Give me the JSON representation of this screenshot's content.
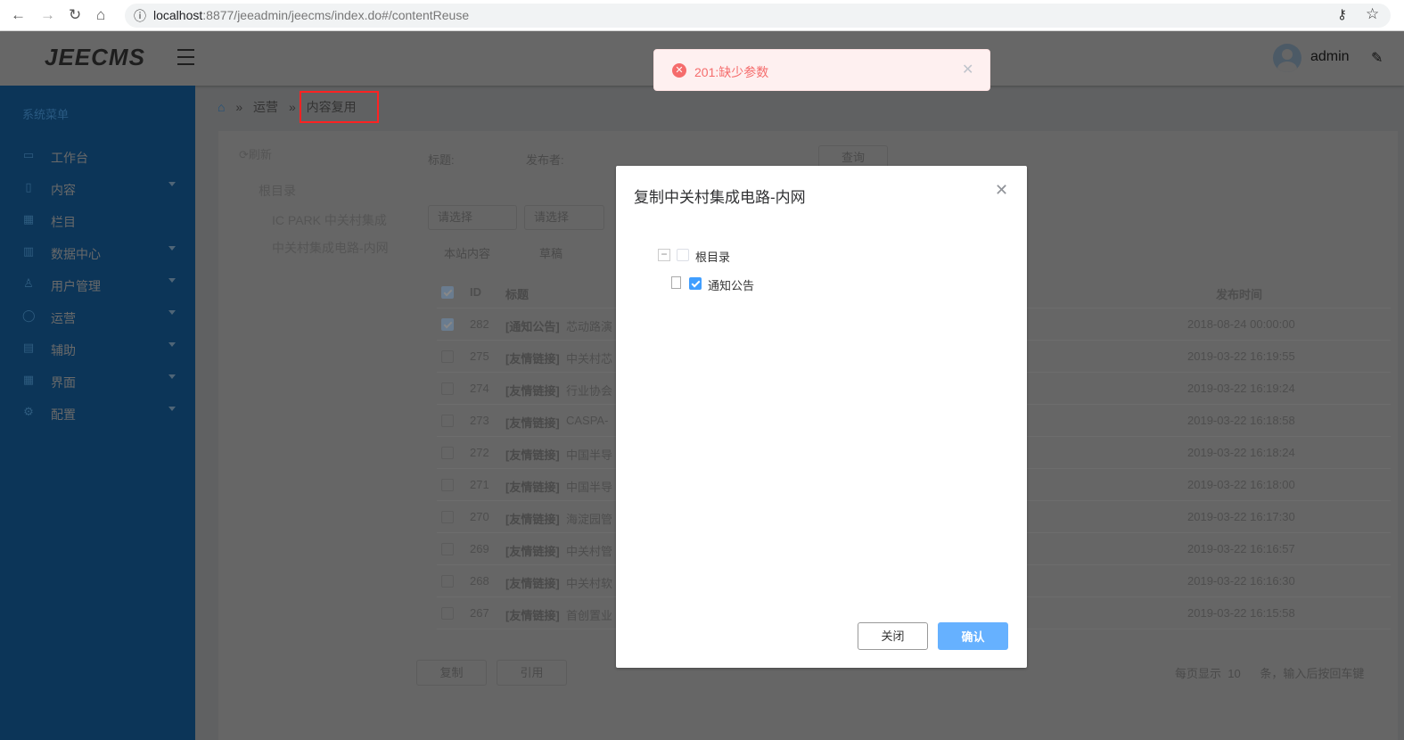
{
  "browser": {
    "url_host": "localhost",
    "url_path": ":8877/jeeadmin/jeecms/index.do#/contentReuse",
    "back": "←",
    "forward": "→",
    "reload": "↻",
    "home": "⌂",
    "info": "ⓘ",
    "key": "⚷",
    "star": "☆"
  },
  "header": {
    "logo": "JEECMS",
    "user": "admin",
    "edit_icon": "✎"
  },
  "sidebar": {
    "caption": "系统菜单",
    "items": [
      {
        "label": "工作台",
        "icon": "▭",
        "arrow": false
      },
      {
        "label": "内容",
        "icon": "▯",
        "arrow": true
      },
      {
        "label": "栏目",
        "icon": "▦",
        "arrow": false
      },
      {
        "label": "数据中心",
        "icon": "▥",
        "arrow": true
      },
      {
        "label": "用户管理",
        "icon": "♙",
        "arrow": true
      },
      {
        "label": "运营",
        "icon": "◯",
        "arrow": true
      },
      {
        "label": "辅助",
        "icon": "▤",
        "arrow": true
      },
      {
        "label": "界面",
        "icon": "▦",
        "arrow": true
      },
      {
        "label": "配置",
        "icon": "⚙",
        "arrow": true
      }
    ]
  },
  "breadcrumb": {
    "home": "⌂",
    "sep": "»",
    "items": [
      "运营",
      "内容复用"
    ]
  },
  "content": {
    "refresh": "⟳刷新",
    "tree": [
      "根目录",
      "IC PARK 中关村集成",
      "中关村集成电路-内网"
    ],
    "filters": {
      "title_label": "标题:",
      "publisher_label": "发布者:",
      "query": "查询",
      "select1": "请选择",
      "select2": "请选择",
      "radios": [
        "本站内容",
        "草稿"
      ]
    },
    "table": {
      "headers": [
        "ID",
        "标题",
        "发布时间"
      ],
      "rows": [
        {
          "id": "282",
          "type": "[通知公告]",
          "title": "芯动路演",
          "time": "2018-08-24 00:00:00",
          "checked": true
        },
        {
          "id": "275",
          "type": "[友情链接]",
          "title": "中关村芯",
          "time": "2019-03-22 16:19:55",
          "checked": false
        },
        {
          "id": "274",
          "type": "[友情链接]",
          "title": "行业协会",
          "time": "2019-03-22 16:19:24",
          "checked": false
        },
        {
          "id": "273",
          "type": "[友情链接]",
          "title": "CASPA-",
          "time": "2019-03-22 16:18:58",
          "checked": false
        },
        {
          "id": "272",
          "type": "[友情链接]",
          "title": "中国半导",
          "time": "2019-03-22 16:18:24",
          "checked": false
        },
        {
          "id": "271",
          "type": "[友情链接]",
          "title": "中国半导",
          "time": "2019-03-22 16:18:00",
          "checked": false
        },
        {
          "id": "270",
          "type": "[友情链接]",
          "title": "海淀园管",
          "time": "2019-03-22 16:17:30",
          "checked": false
        },
        {
          "id": "269",
          "type": "[友情链接]",
          "title": "中关村管",
          "time": "2019-03-22 16:16:57",
          "checked": false
        },
        {
          "id": "268",
          "type": "[友情链接]",
          "title": "中关村软",
          "time": "2019-03-22 16:16:30",
          "checked": false
        },
        {
          "id": "267",
          "type": "[友情链接]",
          "title": "首创置业",
          "time": "2019-03-22 16:15:58",
          "checked": false
        }
      ]
    },
    "copy": "复制",
    "cite": "引用",
    "page_size_label": "每页显示",
    "page_size": "10",
    "page_hint": "条，输入后按回车键"
  },
  "dialog": {
    "title": "复制中关村集成电路-内网",
    "close_icon": "✕",
    "tree_root": "根目录",
    "tree_child": "通知公告",
    "expander": "−",
    "close_btn": "关闭",
    "ok_btn": "确认"
  },
  "toast": {
    "message": "201:缺少参数",
    "icon": "✕",
    "close": "✕",
    "color": "#f56c6c"
  }
}
